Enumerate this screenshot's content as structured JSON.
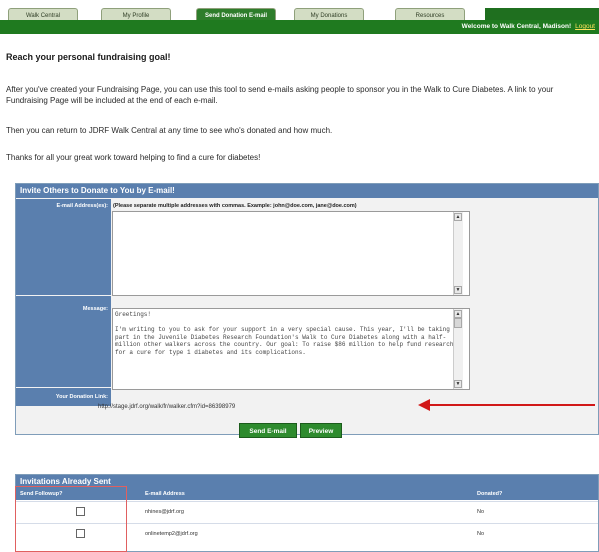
{
  "tabs": [
    {
      "label": "Walk Central",
      "active": false
    },
    {
      "label": "My Profile",
      "active": false
    },
    {
      "label": "Send Donation E-mail",
      "active": true
    },
    {
      "label": "My Donations",
      "active": false
    },
    {
      "label": "Resources",
      "active": false
    }
  ],
  "welcome": {
    "text": "Welcome to Walk Central, Madison!",
    "logout": "Logout"
  },
  "heading": "Reach your personal fundraising goal!",
  "paragraphs": [
    "After you've created your Fundraising Page, you can use this tool to send e-mails asking people to sponsor you in the Walk to Cure Diabetes. A link to your Fundraising Page will be included at the end of each e-mail.",
    "Then you can return to JDRF Walk Central at any time to see who's donated and how much.",
    "Thanks for all your great work toward helping to find a cure for diabetes!"
  ],
  "invite_panel": {
    "title": "Invite Others to Donate to You by E-mail!",
    "email_label": "E-mail Address(es):",
    "email_hint": "(Please separate multiple addresses with commas. Example: john@doe.com, jane@doe.com)",
    "email_value": "",
    "message_label": "Message:",
    "message_value": "Greetings!\n\nI'm writing to you to ask for your support in a very special cause. This year, I'll be taking part in the Juvenile Diabetes Research Foundation's Walk to Cure Diabetes along with a half-million other walkers across the country. Our goal: To raise $86 million to help fund research for a cure for type 1 diabetes and its complications.",
    "link_label": "Your Donation Link:",
    "link_value": "http://stage.jdrf.org/walk/fr/walker.cfm?id=86398979",
    "send_button": "Send E-mail",
    "preview_button": "Preview"
  },
  "sent_panel": {
    "title": "Invitations Already Sent",
    "columns": [
      "Send Followup?",
      "E-mail Address",
      "Donated?"
    ],
    "rows": [
      {
        "email": "nhines@jdrf.org",
        "donated": "No"
      },
      {
        "email": "onlinetemp2@jdrf.org",
        "donated": "No"
      }
    ]
  },
  "colors": {
    "green_bar": "#1f7a1f",
    "panel_header": "#5a7fae",
    "arrow": "#d11818"
  }
}
